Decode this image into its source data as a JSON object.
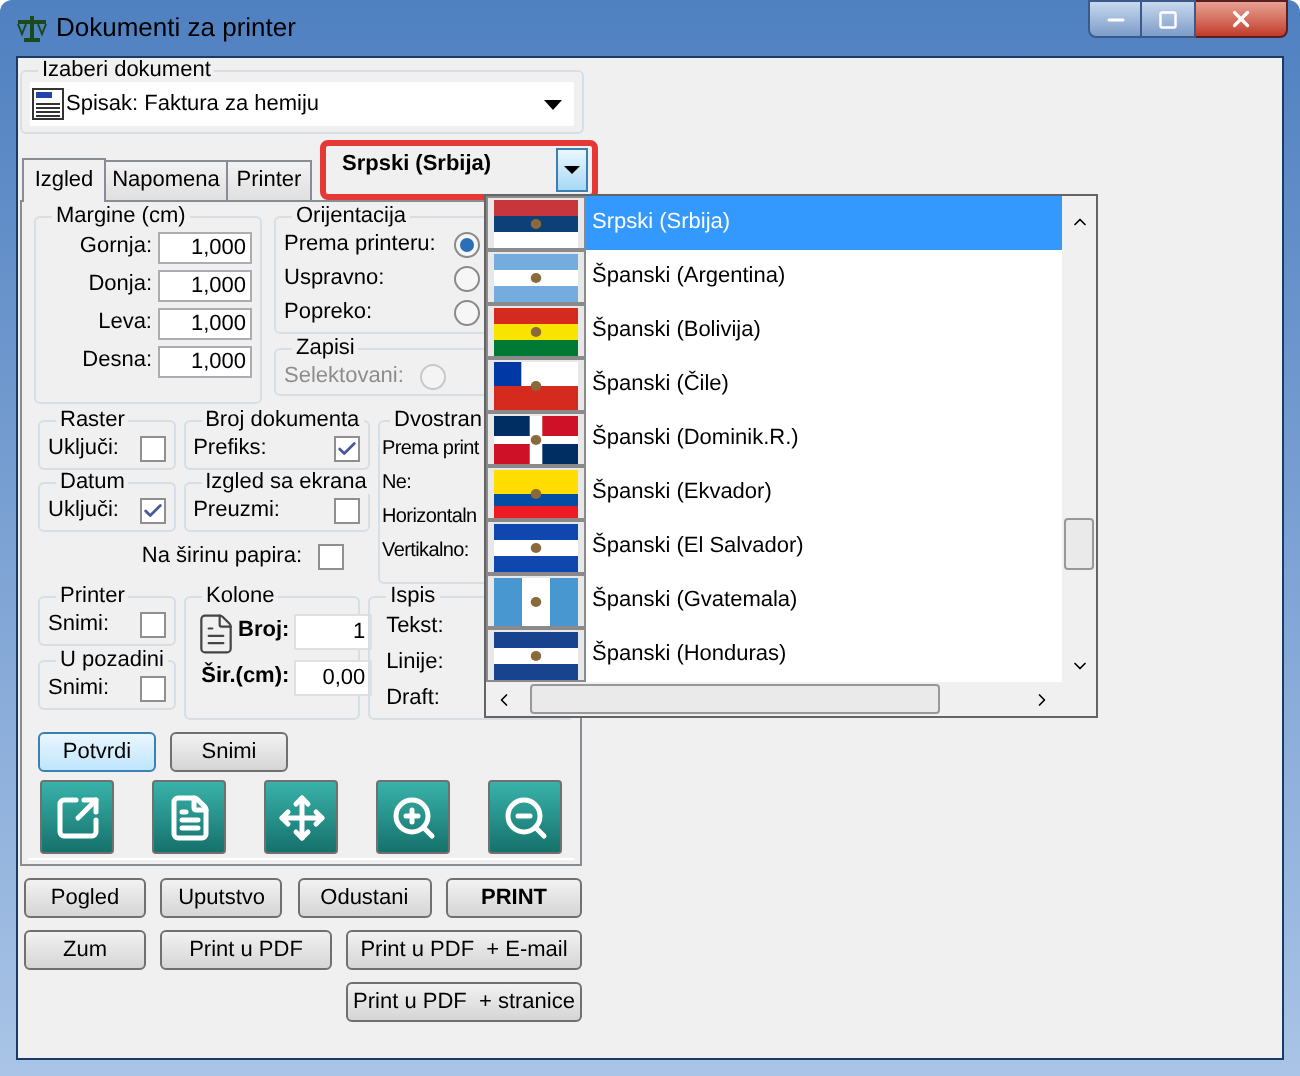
{
  "window": {
    "title": "Dokumenti za printer"
  },
  "document_picker": {
    "title": "Izaberi dokument",
    "value": "Spisak: Faktura za hemiju"
  },
  "tabs": [
    {
      "label": "Izgled",
      "selected": true
    },
    {
      "label": "Napomena",
      "selected": false
    },
    {
      "label": "Printer",
      "selected": false
    }
  ],
  "language": {
    "value": "Srpski (Srbija)"
  },
  "margins": {
    "title": "Margine (cm)",
    "fields": [
      {
        "label": "Gornja:",
        "value": "1,000"
      },
      {
        "label": "Donja:",
        "value": "1,000"
      },
      {
        "label": "Leva:",
        "value": "1,000"
      },
      {
        "label": "Desna:",
        "value": "1,000"
      }
    ]
  },
  "orientation": {
    "title": "Orijentacija",
    "options": [
      {
        "label": "Prema printeru:",
        "selected": true
      },
      {
        "label": "Uspravno:",
        "selected": false
      },
      {
        "label": "Popreko:",
        "selected": false
      }
    ]
  },
  "records": {
    "title": "Zapisi",
    "options": [
      {
        "label": "Selektovani:",
        "selected": false,
        "disabled": true
      }
    ]
  },
  "raster": {
    "title": "Raster",
    "label": "Uključi:",
    "checked": false
  },
  "doc_number": {
    "title": "Broj dokumenta",
    "label": "Prefiks:",
    "checked": true
  },
  "duplex": {
    "title": "Dvostran",
    "labels": [
      "Prema print",
      "Ne:",
      "Horizontaln",
      "Vertikalno:"
    ]
  },
  "date": {
    "title": "Datum",
    "label": "Uključi:",
    "checked": true
  },
  "screen_layout": {
    "title": "Izgled sa ekrana",
    "label": "Preuzmi:",
    "checked": false
  },
  "paper_width": {
    "label": "Na širinu papira:",
    "checked": false
  },
  "printer": {
    "title": "Printer",
    "label": "Snimi:",
    "checked": false
  },
  "background": {
    "title": "U pozadini",
    "label": "Snimi:",
    "checked": false
  },
  "columns": {
    "title": "Kolone",
    "fields": [
      {
        "label": "Broj:",
        "value": "1"
      },
      {
        "label": "Šir.(cm):",
        "value": "0,00"
      }
    ]
  },
  "output": {
    "title": "Ispis",
    "labels": [
      "Tekst:",
      "Linije:",
      "Draft:"
    ]
  },
  "form_buttons": [
    {
      "label": "Potvrdi",
      "focused": true
    },
    {
      "label": "Snimi",
      "focused": false
    }
  ],
  "action_rows": [
    [
      {
        "label": "Pogled",
        "bold": false
      },
      {
        "label": "Uputstvo",
        "bold": false
      },
      {
        "label": "Odustani",
        "bold": false
      },
      {
        "label": "PRINT",
        "bold": true
      }
    ],
    [
      {
        "label": "Zum",
        "bold": false
      },
      {
        "label": "Print u PDF",
        "bold": false
      },
      {
        "label": "Print u PDF  + E-mail",
        "bold": false
      }
    ],
    [
      {
        "label": "Print u PDF  + stranice",
        "bold": false
      }
    ]
  ],
  "language_list": {
    "items": [
      {
        "label": "Srpski (Srbija)",
        "selected": true
      },
      {
        "label": "Španski (Argentina)",
        "selected": false
      },
      {
        "label": "Španski (Bolivija)",
        "selected": false
      },
      {
        "label": "Španski (Čile)",
        "selected": false
      },
      {
        "label": "Španski (Dominik.R.)",
        "selected": false
      },
      {
        "label": "Španski (Ekvador)",
        "selected": false
      },
      {
        "label": "Španski (El Salvador)",
        "selected": false
      },
      {
        "label": "Španski (Gvatemala)",
        "selected": false
      },
      {
        "label": "Španski (Honduras)",
        "selected": false
      }
    ]
  }
}
